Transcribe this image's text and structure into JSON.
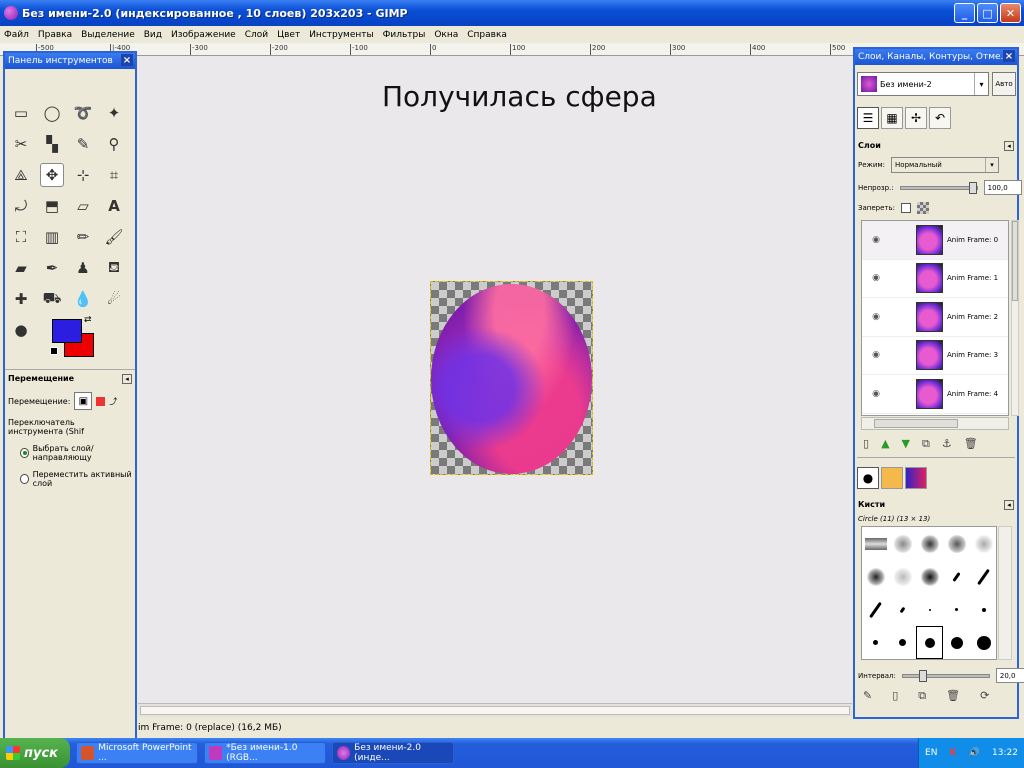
{
  "window": {
    "title": "Без имени-2.0 (индексированное , 10 слоев) 203x203 - GIMP",
    "minimize": "_",
    "maximize": "□",
    "close": "✕"
  },
  "menu": [
    "Файл",
    "Правка",
    "Выделение",
    "Вид",
    "Изображение",
    "Слой",
    "Цвет",
    "Инструменты",
    "Фильтры",
    "Окна",
    "Справка"
  ],
  "ruler_ticks": [
    "-500",
    "|-400",
    "-300",
    "-200",
    "-100",
    "0",
    "100",
    "200",
    "300",
    "400",
    "500"
  ],
  "canvas": {
    "slide_title": "Получилась сфера"
  },
  "toolbox": {
    "title": "Панель инструментов",
    "options_title": "Перемещение",
    "move_label": "Перемещение:",
    "switch_label": "Переключатель инструмента  (Shif",
    "radio_1": "Выбрать слой/направляющу",
    "radio_2": "Переместить активный слой",
    "colors": {
      "fg": "#2b1ee0",
      "bg": "#ee0000"
    }
  },
  "statusbar": {
    "text": "im Frame: 0 (replace) (16,2 МБ)"
  },
  "dock": {
    "title": "Слои, Каналы, Контуры, Отме...",
    "image_name": "Без имени-2",
    "auto_label": "Авто",
    "layers_section": "Слои",
    "mode_label": "Режим:",
    "mode_value": "Нормальный",
    "opacity_label": "Непрозр.:",
    "opacity_value": "100,0",
    "opacity_fraction": 1.0,
    "lock_label": "Запереть:",
    "layers": [
      {
        "name": "Anim Frame: 0"
      },
      {
        "name": "Anim Frame: 1"
      },
      {
        "name": "Anim Frame: 2"
      },
      {
        "name": "Anim Frame: 3"
      },
      {
        "name": "Anim Frame: 4"
      }
    ],
    "brushes_section": "Кисти",
    "brush_name": "Circle (11) (13 × 13)",
    "spacing_label": "Интервал:",
    "spacing_value": "20,0",
    "spacing_fraction": 0.2
  },
  "taskbar": {
    "start": "пуск",
    "tasks": [
      {
        "label": "Microsoft PowerPoint ..."
      },
      {
        "label": "*Без имени-1.0 (RGB..."
      },
      {
        "label": "Без имени-2.0 (инде..."
      }
    ],
    "lang": "EN",
    "clock": "13:22"
  }
}
